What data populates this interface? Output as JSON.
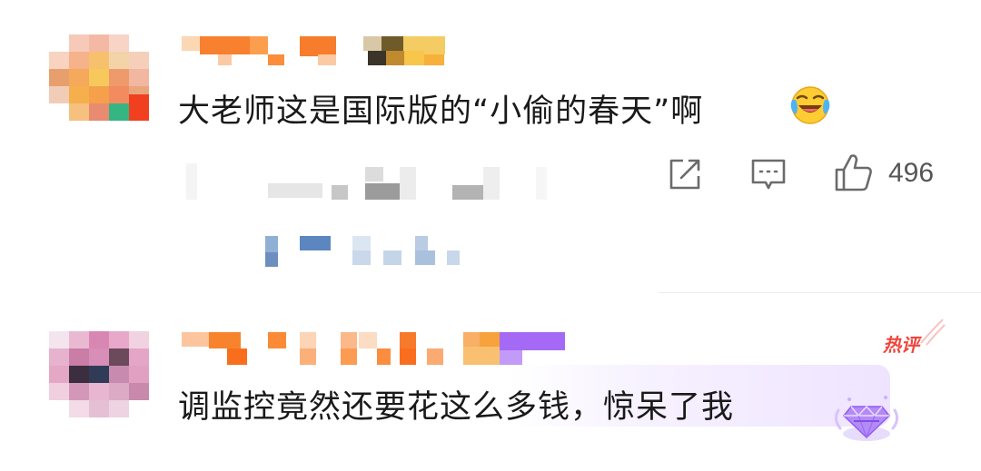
{
  "comments": [
    {
      "text": "大老师这是国际版的“小偷的春天”啊",
      "emoji": "laugh-cry-emoji",
      "actions": {
        "share_icon": "share-icon",
        "reply_icon": "comment-icon",
        "like_icon": "thumbs-up-icon",
        "like_count": "496"
      }
    },
    {
      "text": "调监控竟然还要花这么多钱，惊呆了我",
      "badge": "热评",
      "decoration": "diamond-gem-icon"
    }
  ],
  "colors": {
    "hot_badge": "#f0443c",
    "text": "#1a1a1a",
    "action_gray": "#555555",
    "highlight": "#efe4ff"
  }
}
